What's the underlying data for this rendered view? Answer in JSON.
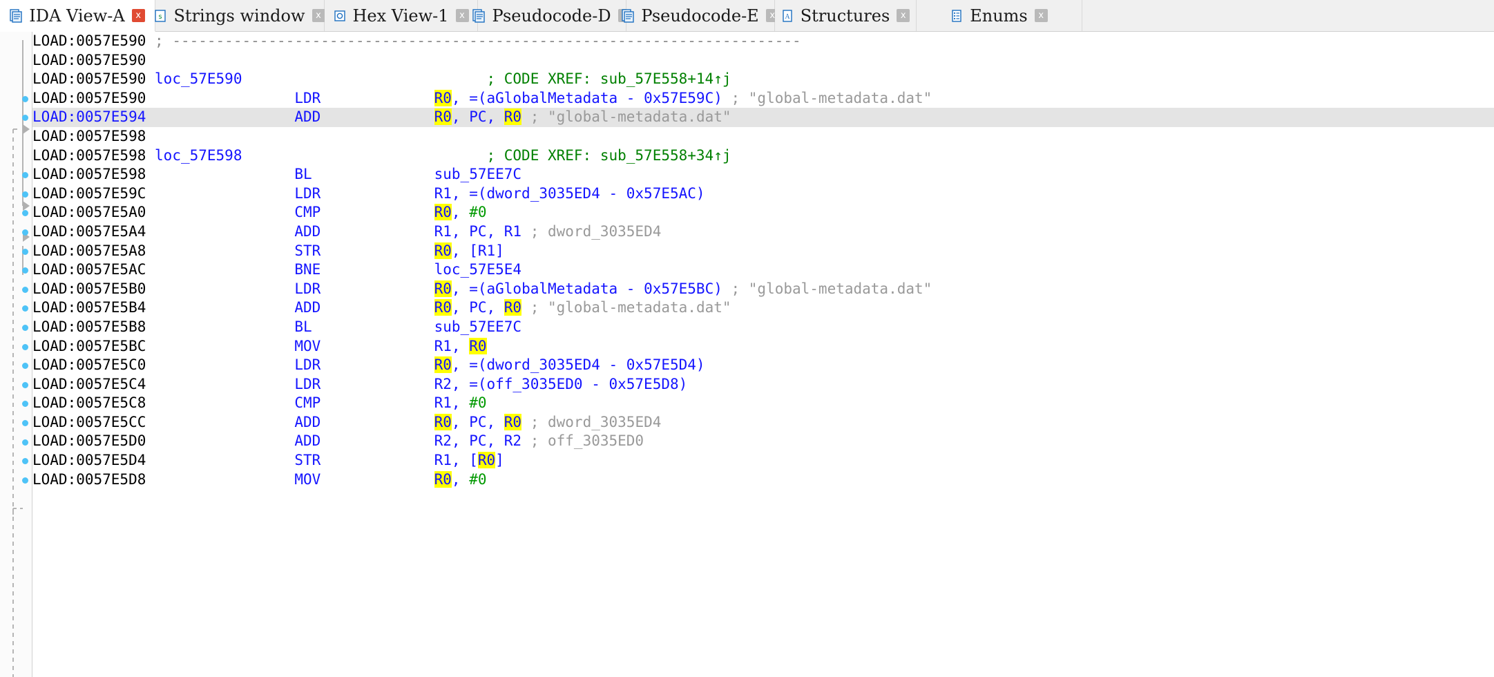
{
  "window": {
    "title": "IDA View-A"
  },
  "tabs": [
    {
      "label": "IDA View-A",
      "icon": "ida-view-icon",
      "active": true,
      "close": "x"
    },
    {
      "label": "Strings window",
      "icon": "strings-icon",
      "active": false,
      "close": "x"
    },
    {
      "label": "Hex View-1",
      "icon": "hex-view-icon",
      "active": false,
      "close": "x"
    },
    {
      "label": "Pseudocode-D",
      "icon": "pseudocode-icon",
      "active": false,
      "close": "x"
    },
    {
      "label": "Pseudocode-E",
      "icon": "pseudocode-icon",
      "active": false,
      "close": "x"
    },
    {
      "label": "Structures",
      "icon": "structures-icon",
      "active": false,
      "close": "x"
    },
    {
      "label": "Enums",
      "icon": "enums-icon",
      "active": false,
      "close": "x"
    }
  ],
  "colors": {
    "address": "#000000",
    "address_selected": "#1414ff",
    "label": "#1414ff",
    "mnemonic": "#1414ff",
    "operand": "#1414ff",
    "immediate": "#009900",
    "xref_comment": "#008000",
    "repeatable_comment": "#999999",
    "highlight": "#ffff00",
    "selected_row": "#e4e4e4",
    "gutter_dot": "#4ec3f7",
    "tab_active_close": "#e04a32"
  },
  "disassembly": {
    "segment": "LOAD",
    "lines": [
      {
        "addr": "LOAD:0057E590",
        "marker": false,
        "selected": false,
        "parts": [
          {
            "t": " ; ",
            "c": "semi"
          },
          {
            "t": "------------------------------------------------------------------------",
            "c": "dashes"
          }
        ]
      },
      {
        "addr": "LOAD:0057E590",
        "marker": false,
        "selected": false,
        "parts": []
      },
      {
        "addr": "LOAD:0057E590",
        "marker": false,
        "selected": false,
        "parts": [
          {
            "t": " ",
            "c": "seg"
          },
          {
            "t": "loc_57E590",
            "c": "label"
          },
          {
            "t": "                            ",
            "c": "seg"
          },
          {
            "t": "; CODE XREF: sub_57E558+14↑j",
            "c": "xref"
          }
        ]
      },
      {
        "addr": "LOAD:0057E590",
        "marker": true,
        "selected": false,
        "parts": [
          {
            "t": "                 ",
            "c": "seg"
          },
          {
            "t": "LDR",
            "c": "mnem"
          },
          {
            "t": "             ",
            "c": "seg"
          },
          {
            "t": "R0",
            "c": "oper",
            "hl": true
          },
          {
            "t": ", =(aGlobalMetadata - 0x57E59C)",
            "c": "oper"
          },
          {
            "t": " ; \"global-metadata.dat\"",
            "c": "rcmt"
          }
        ]
      },
      {
        "addr": "LOAD:0057E594",
        "marker": true,
        "selected": true,
        "parts": [
          {
            "t": "                 ",
            "c": "seg"
          },
          {
            "t": "ADD",
            "c": "mnem"
          },
          {
            "t": "             ",
            "c": "seg"
          },
          {
            "t": "",
            "c": "caret"
          },
          {
            "t": "R0",
            "c": "oper",
            "hl": true
          },
          {
            "t": ", PC, ",
            "c": "oper"
          },
          {
            "t": "R0",
            "c": "oper",
            "hl": true
          },
          {
            "t": " ; \"global-metadata.dat\"",
            "c": "rcmt"
          }
        ]
      },
      {
        "addr": "LOAD:0057E598",
        "marker": false,
        "selected": false,
        "parts": []
      },
      {
        "addr": "LOAD:0057E598",
        "marker": false,
        "selected": false,
        "parts": [
          {
            "t": " ",
            "c": "seg"
          },
          {
            "t": "loc_57E598",
            "c": "label"
          },
          {
            "t": "                            ",
            "c": "seg"
          },
          {
            "t": "; CODE XREF: sub_57E558+34↑j",
            "c": "xref"
          }
        ]
      },
      {
        "addr": "LOAD:0057E598",
        "marker": true,
        "selected": false,
        "parts": [
          {
            "t": "                 ",
            "c": "seg"
          },
          {
            "t": "BL",
            "c": "mnem"
          },
          {
            "t": "              ",
            "c": "seg"
          },
          {
            "t": "sub_57EE7C",
            "c": "oper"
          }
        ]
      },
      {
        "addr": "LOAD:0057E59C",
        "marker": true,
        "selected": false,
        "parts": [
          {
            "t": "                 ",
            "c": "seg"
          },
          {
            "t": "LDR",
            "c": "mnem"
          },
          {
            "t": "             ",
            "c": "seg"
          },
          {
            "t": "R1, =(dword_3035ED4 - 0x57E5AC)",
            "c": "oper"
          }
        ]
      },
      {
        "addr": "LOAD:0057E5A0",
        "marker": true,
        "selected": false,
        "parts": [
          {
            "t": "                 ",
            "c": "seg"
          },
          {
            "t": "CMP",
            "c": "mnem"
          },
          {
            "t": "             ",
            "c": "seg"
          },
          {
            "t": "R0",
            "c": "oper",
            "hl": true
          },
          {
            "t": ", ",
            "c": "oper"
          },
          {
            "t": "#0",
            "c": "imm"
          }
        ]
      },
      {
        "addr": "LOAD:0057E5A4",
        "marker": true,
        "selected": false,
        "parts": [
          {
            "t": "                 ",
            "c": "seg"
          },
          {
            "t": "ADD",
            "c": "mnem"
          },
          {
            "t": "             ",
            "c": "seg"
          },
          {
            "t": "R1, PC, R1",
            "c": "oper"
          },
          {
            "t": " ; dword_3035ED4",
            "c": "rcmt"
          }
        ]
      },
      {
        "addr": "LOAD:0057E5A8",
        "marker": true,
        "selected": false,
        "parts": [
          {
            "t": "                 ",
            "c": "seg"
          },
          {
            "t": "STR",
            "c": "mnem"
          },
          {
            "t": "             ",
            "c": "seg"
          },
          {
            "t": "R0",
            "c": "oper",
            "hl": true
          },
          {
            "t": ", [R1]",
            "c": "oper"
          }
        ]
      },
      {
        "addr": "LOAD:0057E5AC",
        "marker": true,
        "selected": false,
        "parts": [
          {
            "t": "                 ",
            "c": "seg"
          },
          {
            "t": "BNE",
            "c": "mnem"
          },
          {
            "t": "             ",
            "c": "seg"
          },
          {
            "t": "loc_57E5E4",
            "c": "oper"
          }
        ]
      },
      {
        "addr": "LOAD:0057E5B0",
        "marker": true,
        "selected": false,
        "parts": [
          {
            "t": "                 ",
            "c": "seg"
          },
          {
            "t": "LDR",
            "c": "mnem"
          },
          {
            "t": "             ",
            "c": "seg"
          },
          {
            "t": "R0",
            "c": "oper",
            "hl": true
          },
          {
            "t": ", =(aGlobalMetadata - 0x57E5BC)",
            "c": "oper"
          },
          {
            "t": " ; \"global-metadata.dat\"",
            "c": "rcmt"
          }
        ]
      },
      {
        "addr": "LOAD:0057E5B4",
        "marker": true,
        "selected": false,
        "parts": [
          {
            "t": "                 ",
            "c": "seg"
          },
          {
            "t": "ADD",
            "c": "mnem"
          },
          {
            "t": "             ",
            "c": "seg"
          },
          {
            "t": "R0",
            "c": "oper",
            "hl": true
          },
          {
            "t": ", PC, ",
            "c": "oper"
          },
          {
            "t": "R0",
            "c": "oper",
            "hl": true
          },
          {
            "t": " ; \"global-metadata.dat\"",
            "c": "rcmt"
          }
        ]
      },
      {
        "addr": "LOAD:0057E5B8",
        "marker": true,
        "selected": false,
        "parts": [
          {
            "t": "                 ",
            "c": "seg"
          },
          {
            "t": "BL",
            "c": "mnem"
          },
          {
            "t": "              ",
            "c": "seg"
          },
          {
            "t": "sub_57EE7C",
            "c": "oper"
          }
        ]
      },
      {
        "addr": "LOAD:0057E5BC",
        "marker": true,
        "selected": false,
        "parts": [
          {
            "t": "                 ",
            "c": "seg"
          },
          {
            "t": "MOV",
            "c": "mnem"
          },
          {
            "t": "             ",
            "c": "seg"
          },
          {
            "t": "R1, ",
            "c": "oper"
          },
          {
            "t": "R0",
            "c": "oper",
            "hl": true
          }
        ]
      },
      {
        "addr": "LOAD:0057E5C0",
        "marker": true,
        "selected": false,
        "parts": [
          {
            "t": "                 ",
            "c": "seg"
          },
          {
            "t": "LDR",
            "c": "mnem"
          },
          {
            "t": "             ",
            "c": "seg"
          },
          {
            "t": "R0",
            "c": "oper",
            "hl": true
          },
          {
            "t": ", =(dword_3035ED4 - 0x57E5D4)",
            "c": "oper"
          }
        ]
      },
      {
        "addr": "LOAD:0057E5C4",
        "marker": true,
        "selected": false,
        "parts": [
          {
            "t": "                 ",
            "c": "seg"
          },
          {
            "t": "LDR",
            "c": "mnem"
          },
          {
            "t": "             ",
            "c": "seg"
          },
          {
            "t": "R2, =(off_3035ED0 - 0x57E5D8)",
            "c": "oper"
          }
        ]
      },
      {
        "addr": "LOAD:0057E5C8",
        "marker": true,
        "selected": false,
        "parts": [
          {
            "t": "                 ",
            "c": "seg"
          },
          {
            "t": "CMP",
            "c": "mnem"
          },
          {
            "t": "             ",
            "c": "seg"
          },
          {
            "t": "R1, ",
            "c": "oper"
          },
          {
            "t": "#0",
            "c": "imm"
          }
        ]
      },
      {
        "addr": "LOAD:0057E5CC",
        "marker": true,
        "selected": false,
        "parts": [
          {
            "t": "                 ",
            "c": "seg"
          },
          {
            "t": "ADD",
            "c": "mnem"
          },
          {
            "t": "             ",
            "c": "seg"
          },
          {
            "t": "R0",
            "c": "oper",
            "hl": true
          },
          {
            "t": ", PC, ",
            "c": "oper"
          },
          {
            "t": "R0",
            "c": "oper",
            "hl": true
          },
          {
            "t": " ; dword_3035ED4",
            "c": "rcmt"
          }
        ]
      },
      {
        "addr": "LOAD:0057E5D0",
        "marker": true,
        "selected": false,
        "parts": [
          {
            "t": "                 ",
            "c": "seg"
          },
          {
            "t": "ADD",
            "c": "mnem"
          },
          {
            "t": "             ",
            "c": "seg"
          },
          {
            "t": "R2, PC, R2",
            "c": "oper"
          },
          {
            "t": " ; off_3035ED0",
            "c": "rcmt"
          }
        ]
      },
      {
        "addr": "LOAD:0057E5D4",
        "marker": true,
        "selected": false,
        "parts": [
          {
            "t": "                 ",
            "c": "seg"
          },
          {
            "t": "STR",
            "c": "mnem"
          },
          {
            "t": "             ",
            "c": "seg"
          },
          {
            "t": "R1, [",
            "c": "oper"
          },
          {
            "t": "R0",
            "c": "oper",
            "hl": true
          },
          {
            "t": "]",
            "c": "oper"
          }
        ]
      },
      {
        "addr": "LOAD:0057E5D8",
        "marker": true,
        "selected": false,
        "parts": [
          {
            "t": "                 ",
            "c": "seg"
          },
          {
            "t": "MOV",
            "c": "mnem"
          },
          {
            "t": "             ",
            "c": "seg"
          },
          {
            "t": "R0",
            "c": "oper",
            "hl": true
          },
          {
            "t": ", ",
            "c": "oper"
          },
          {
            "t": "#0",
            "c": "imm"
          }
        ]
      }
    ]
  }
}
